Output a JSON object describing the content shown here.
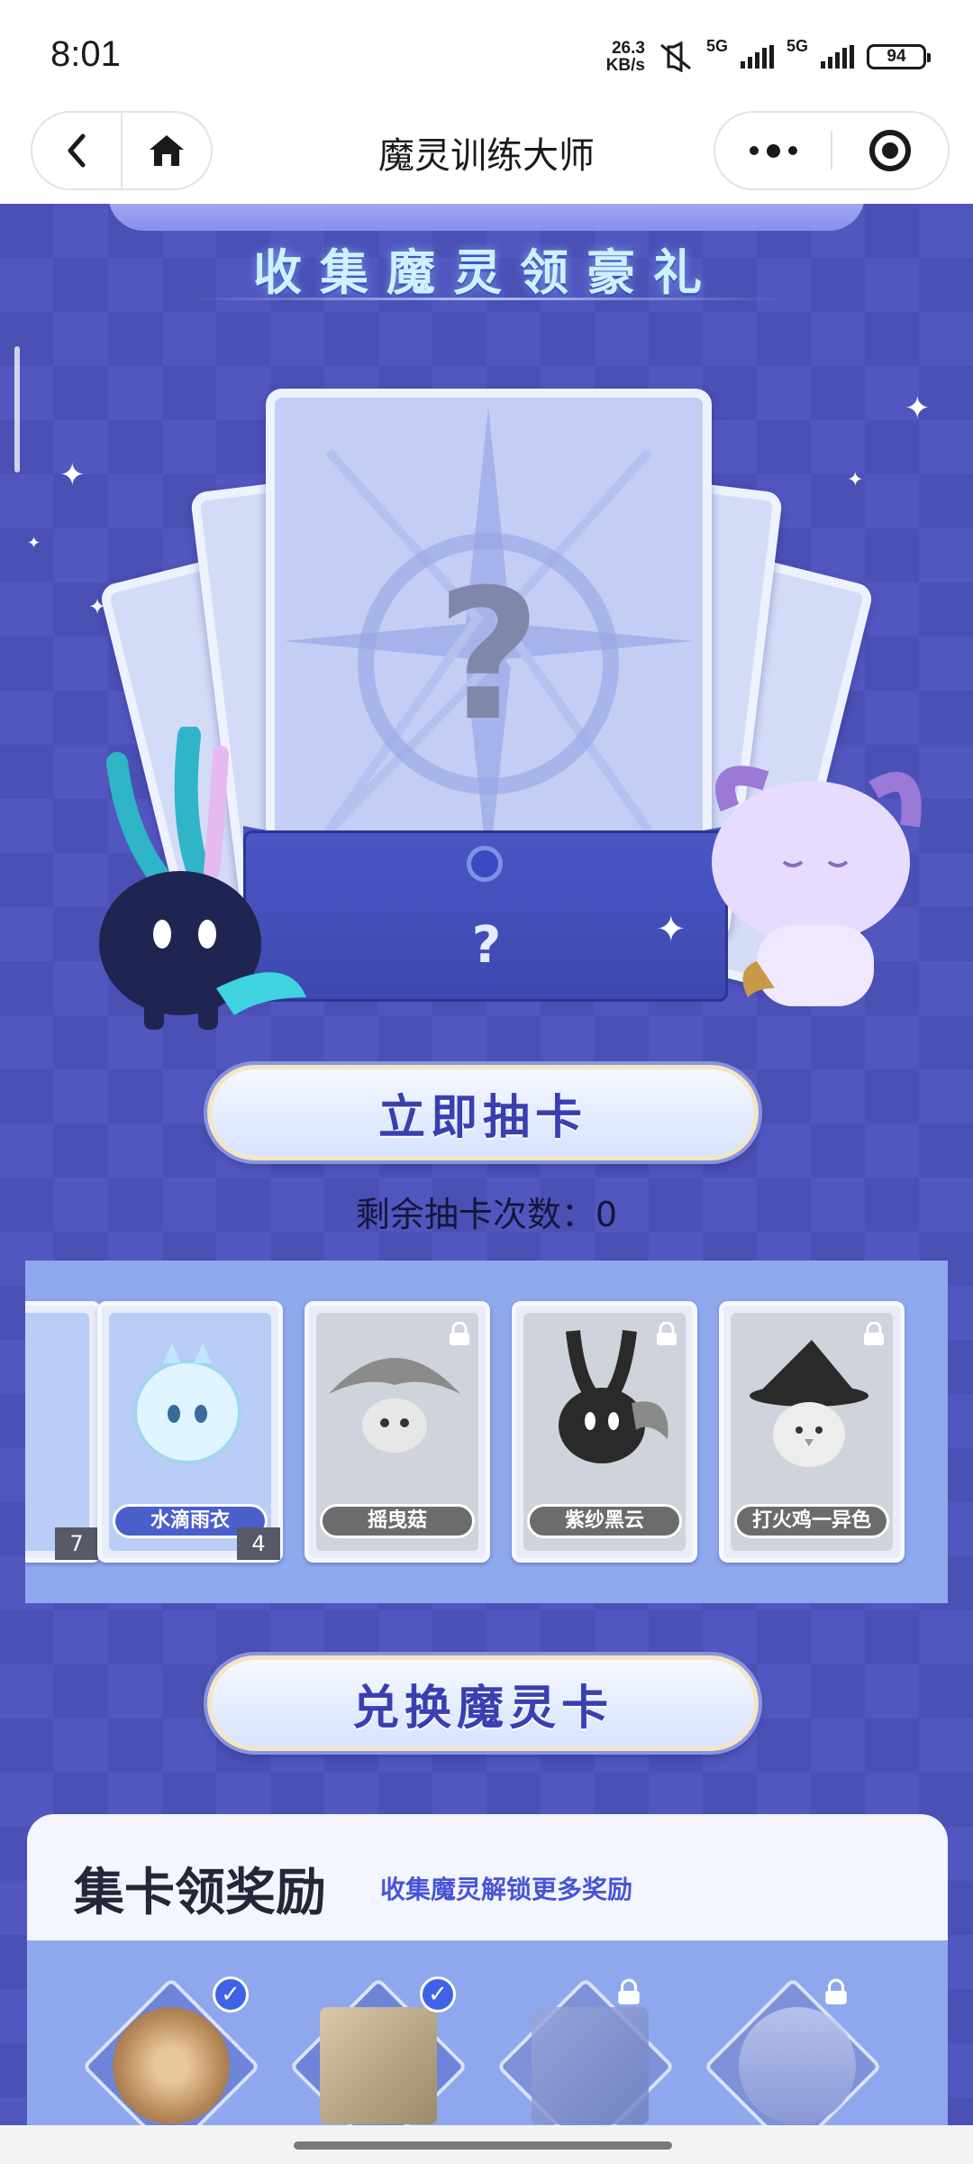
{
  "status_bar": {
    "time": "8:01",
    "net_speed_value": "26.3",
    "net_speed_unit": "KB/s",
    "sim1": "5G",
    "sim2": "5G",
    "battery": "94"
  },
  "title_bar": {
    "title": "魔灵训练大师"
  },
  "banner": {
    "subtitle": "收集魔灵领豪礼"
  },
  "draw": {
    "button_label": "立即抽卡",
    "remaining_text": "剩余抽卡次数：0",
    "card_mark": "?",
    "envelope_mark": "?"
  },
  "cards": [
    {
      "name": "",
      "count": "7",
      "owned": true
    },
    {
      "name": "水滴雨衣",
      "count": "4",
      "owned": true
    },
    {
      "name": "摇曳菇",
      "count": "",
      "owned": false
    },
    {
      "name": "紫纱黑云",
      "count": "",
      "owned": false
    },
    {
      "name": "打火鸡一异色",
      "count": "",
      "owned": false
    }
  ],
  "redeem": {
    "button_label": "兑换魔灵卡"
  },
  "rewards": {
    "title": "集卡领奖励",
    "subtitle": "收集魔灵解锁更多奖励",
    "items": [
      {
        "icon": "shield-token-icon",
        "claimed": true
      },
      {
        "icon": "scroll-map-icon",
        "claimed": true
      },
      {
        "icon": "book-icon",
        "claimed": false
      },
      {
        "icon": "hourglass-icon",
        "claimed": false
      }
    ]
  },
  "colors": {
    "background": "#4a4fb3",
    "accent": "#3a3fb0",
    "strip": "#8fa7ec"
  }
}
